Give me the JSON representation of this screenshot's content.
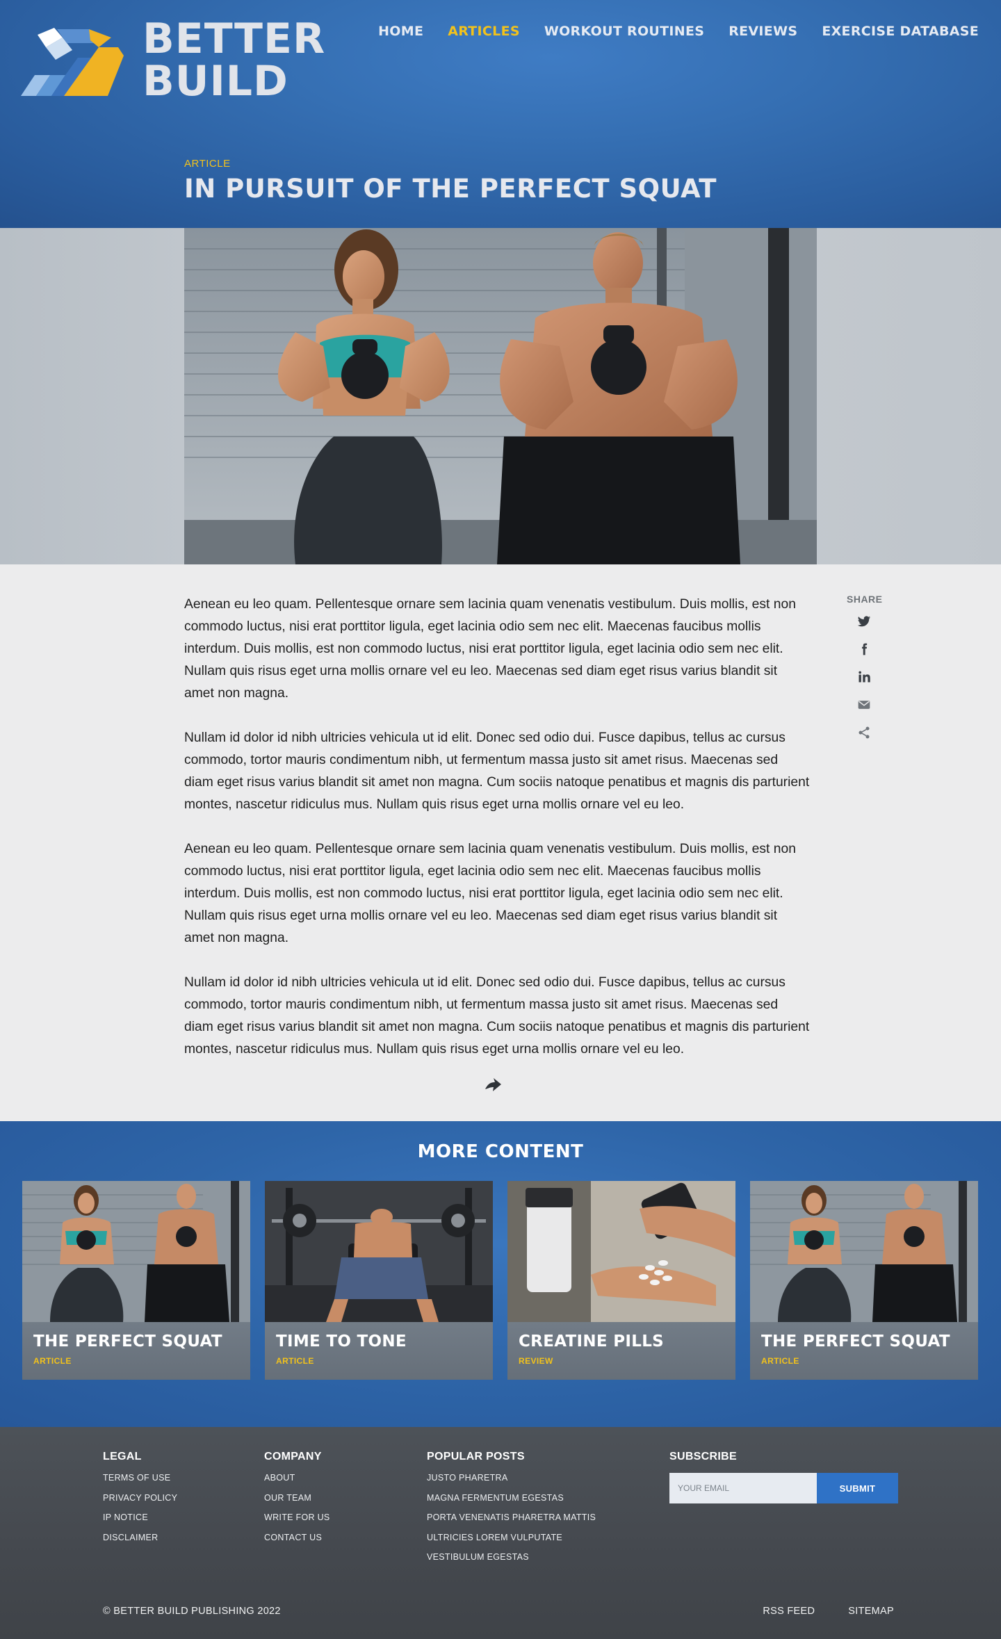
{
  "brand": {
    "name_line1": "BETTER",
    "name_line2": "BUILD"
  },
  "nav": {
    "items": [
      {
        "label": "HOME"
      },
      {
        "label": "ARTICLES"
      },
      {
        "label": "WORKOUT ROUTINES"
      },
      {
        "label": "REVIEWS"
      },
      {
        "label": "EXERCISE DATABASE"
      }
    ]
  },
  "article": {
    "category": "ARTICLE",
    "title": "IN PURSUIT OF THE PERFECT SQUAT",
    "paragraphs": [
      "Aenean eu leo quam. Pellentesque ornare sem lacinia quam venenatis vestibulum. Duis mollis, est non commodo luctus, nisi erat porttitor ligula, eget lacinia odio sem nec elit. Maecenas faucibus mollis interdum. Duis mollis, est non commodo luctus, nisi erat porttitor ligula, eget lacinia odio sem nec elit. Nullam quis risus eget urna mollis ornare vel eu leo. Maecenas sed diam eget risus varius blandit sit amet non magna.",
      "Nullam id dolor id nibh ultricies vehicula ut id elit. Donec sed odio dui. Fusce dapibus, tellus ac cursus commodo, tortor mauris condimentum nibh, ut fermentum massa justo sit amet risus. Maecenas sed diam eget risus varius blandit sit amet non magna. Cum sociis natoque penatibus et magnis dis parturient montes, nascetur ridiculus mus. Nullam quis risus eget urna mollis ornare vel eu leo.",
      "Aenean eu leo quam. Pellentesque ornare sem lacinia quam venenatis vestibulum. Duis mollis, est non commodo luctus, nisi erat porttitor ligula, eget lacinia odio sem nec elit. Maecenas faucibus mollis interdum. Duis mollis, est non commodo luctus, nisi erat porttitor ligula, eget lacinia odio sem nec elit. Nullam quis risus eget urna mollis ornare vel eu leo. Maecenas sed diam eget risus varius blandit sit amet non magna.",
      "Nullam id dolor id nibh ultricies vehicula ut id elit. Donec sed odio dui. Fusce dapibus, tellus ac cursus commodo, tortor mauris condimentum nibh, ut fermentum massa justo sit amet risus. Maecenas sed diam eget risus varius blandit sit amet non magna. Cum sociis natoque penatibus et magnis dis parturient montes, nascetur ridiculus mus. Nullam quis risus eget urna mollis ornare vel eu leo."
    ]
  },
  "share": {
    "label": "SHARE",
    "icons": [
      "twitter-icon",
      "facebook-icon",
      "linkedin-icon",
      "email-icon",
      "share-icon"
    ]
  },
  "more_content": {
    "title": "MORE CONTENT",
    "cards": [
      {
        "title": "THE PERFECT SQUAT",
        "type": "ARTICLE"
      },
      {
        "title": "TIME TO TONE",
        "type": "ARTICLE"
      },
      {
        "title": "CREATINE PILLS",
        "type": "REVIEW"
      },
      {
        "title": "THE PERFECT SQUAT",
        "type": "ARTICLE"
      }
    ]
  },
  "footer": {
    "legal": {
      "heading": "LEGAL",
      "links": [
        "TERMS OF USE",
        "PRIVACY POLICY",
        "IP NOTICE",
        "DISCLAIMER"
      ]
    },
    "company": {
      "heading": "COMPANY",
      "links": [
        "ABOUT",
        "OUR TEAM",
        "WRITE FOR US",
        "CONTACT US"
      ]
    },
    "popular": {
      "heading": "POPULAR POSTS",
      "links": [
        "JUSTO PHARETRA",
        "MAGNA FERMENTUM EGESTAS",
        "PORTA VENENATIS PHARETRA MATTIS",
        "ULTRICIES LOREM VULPUTATE",
        "VESTIBULUM EGESTAS"
      ]
    },
    "subscribe": {
      "heading": "SUBSCRIBE",
      "placeholder": "YOUR EMAIL",
      "button": "SUBMIT"
    },
    "copyright": "© BETTER BUILD PUBLISHING 2022",
    "bottom_links": [
      "RSS FEED",
      "SITEMAP"
    ]
  },
  "colors": {
    "brand_blue": "#2f6db3",
    "accent_yellow": "#f2c21b",
    "footer_gray": "#474b51",
    "submit_blue": "#2f72c6"
  }
}
